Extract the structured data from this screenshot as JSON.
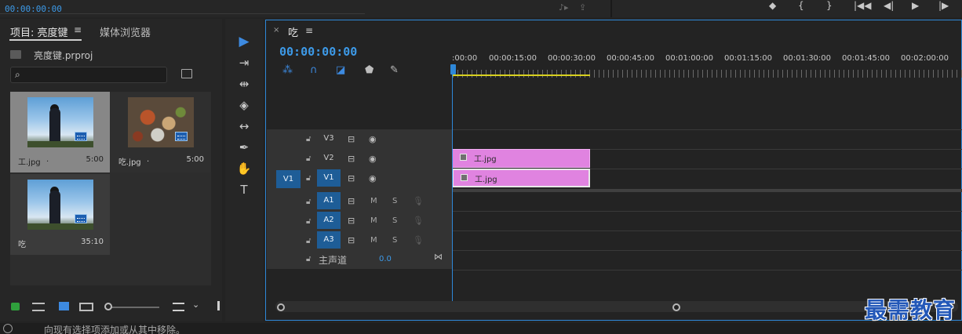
{
  "top": {
    "timecode": "00:00:00:00",
    "program_controls": [
      "◆",
      "{",
      "}",
      "|◀◀",
      "◀|",
      "▶",
      "|▶"
    ]
  },
  "project": {
    "tab_project": "项目: 亮度键",
    "tab_menu": "≡",
    "tab_media": "媒体浏览器",
    "file_name": "亮度键.prproj",
    "items": [
      {
        "name": "工.jpg",
        "dot": ".",
        "duration": "5:00"
      },
      {
        "name": "吃.jpg",
        "dot": ".",
        "duration": "5:00"
      },
      {
        "name": "吃",
        "dot": "",
        "duration": "35:10"
      }
    ]
  },
  "tools": [
    "▶",
    "⇥",
    "⇹",
    "◈",
    "↔",
    "✒",
    "✋",
    "T"
  ],
  "timeline": {
    "close": "×",
    "title": "吃",
    "menu": "≡",
    "timecode": "00:00:00:00",
    "ruler": [
      ":00:00",
      "00:00:15:00",
      "00:00:30:00",
      "00:00:45:00",
      "00:01:00:00",
      "00:01:15:00",
      "00:01:30:00",
      "00:01:45:00",
      "00:02:00:00"
    ],
    "video_tracks": [
      {
        "name": "V3",
        "on": false
      },
      {
        "name": "V2",
        "on": false
      },
      {
        "name": "V1",
        "on": true
      }
    ],
    "v1_source": "V1",
    "audio_tracks": [
      {
        "name": "A1",
        "mute": "M",
        "solo": "S"
      },
      {
        "name": "A2",
        "mute": "M",
        "solo": "S"
      },
      {
        "name": "A3",
        "mute": "M",
        "solo": "S"
      }
    ],
    "master_label": "主声道",
    "master_value": "0.0",
    "clips": [
      {
        "track": "V2",
        "name": "工.jpg"
      },
      {
        "track": "V1",
        "name": "工.jpg"
      }
    ]
  },
  "status": {
    "text": "向现有选择项添加或从其中移除。"
  },
  "watermark": "最需教育",
  "colors": {
    "accent": "#2e88d9",
    "timecode": "#3d9ae8",
    "clip": "#e083e0",
    "work_area": "#d8d020"
  }
}
